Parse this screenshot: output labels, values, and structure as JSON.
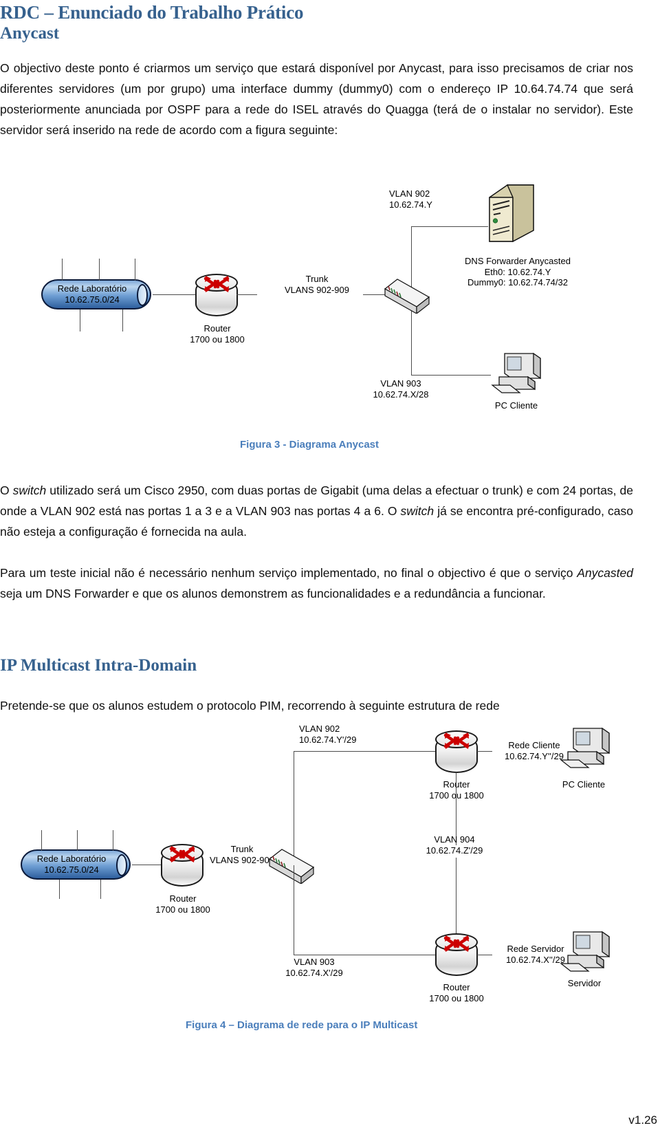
{
  "document": {
    "title": "RDC – Enunciado do Trabalho Prático",
    "version": "v1.26"
  },
  "sections": [
    {
      "id": "anycast",
      "heading": "Anycast",
      "paragraphs": [
        "O objectivo deste ponto é criarmos um serviço que estará disponível por Anycast, para isso precisamos de criar nos diferentes servidores (um por grupo) uma interface dummy (dummy0) com o endereço IP 10.64.74.74 que será posteriormente anunciada por OSPF para a rede do ISEL através do Quagga (terá de o instalar no servidor). Este servidor será inserido na rede de acordo com a figura seguinte:"
      ]
    },
    {
      "id": "multicast",
      "heading": "IP Multicast Intra-Domain",
      "paragraphs": [
        "Pretende-se que os alunos estudem o protocolo PIM, recorrendo à seguinte estrutura de rede"
      ]
    }
  ],
  "body_after_fig3": {
    "p1_pre": "O ",
    "p1_em1": "switch",
    "p1_mid": " utilizado será um Cisco 2950, com duas portas de Gigabit (uma delas a efectuar o trunk) e com 24 portas, de onde a VLAN 902 está nas portas 1 a 3 e a VLAN 903 nas portas 4 a 6. O ",
    "p1_em2": "switch",
    "p1_post": " já se encontra pré-configurado, caso não esteja a configuração é fornecida na aula.",
    "p2_pre": "Para um teste inicial não é necessário nenhum serviço implementado, no final o objectivo é que o serviço ",
    "p2_em1": "Anycasted",
    "p2_post": " seja um DNS Forwarder e que os alunos demonstrem as funcionalidades e a redundância a funcionar."
  },
  "figure3": {
    "caption": "Figura 3 - Diagrama Anycast",
    "nodes": {
      "lab_network": {
        "line1": "Rede Laboratório",
        "line2": "10.62.75.0/24",
        "icon": "network-cylinder-icon"
      },
      "router": {
        "line1": "Router",
        "line2": "1700 ou 1800",
        "icon": "router-icon"
      },
      "trunk": {
        "line1": "Trunk",
        "line2": "VLANS 902-909"
      },
      "switch": {
        "icon": "switch-icon"
      },
      "vlan902": {
        "line1": "VLAN 902",
        "line2": "10.62.74.Y"
      },
      "vlan903": {
        "line1": "VLAN 903",
        "line2": "10.62.74.X/28"
      },
      "server": {
        "icon": "server-tower-icon",
        "line1": "DNS Forwarder Anycasted",
        "line2": "Eth0: 10.62.74.Y",
        "line3": "Dummy0: 10.62.74.74/32"
      },
      "pc_client": {
        "icon": "desktop-pc-icon",
        "label": "PC Cliente"
      }
    }
  },
  "figure4": {
    "caption": "Figura 4 – Diagrama de rede para o IP Multicast",
    "nodes": {
      "vlan902": {
        "line1": "VLAN 902",
        "line2": "10.62.74.Y'/29"
      },
      "router_top": {
        "line1": "Router",
        "line2": "1700 ou 1800",
        "icon": "router-icon"
      },
      "rede_cliente": {
        "line1": "Rede Cliente",
        "line2": "10.62.74.Y''/29"
      },
      "pc_client": {
        "icon": "desktop-pc-icon",
        "label": "PC Cliente"
      },
      "lab_network": {
        "line1": "Rede Laboratório",
        "line2": "10.62.75.0/24",
        "icon": "network-cylinder-icon"
      },
      "router_left": {
        "line1": "Router",
        "line2": "1700 ou 1800",
        "icon": "router-icon"
      },
      "trunk": {
        "line1": "Trunk",
        "line2": "VLANS 902-909"
      },
      "switch": {
        "icon": "switch-icon"
      },
      "vlan904": {
        "line1": "VLAN 904",
        "line2": "10.62.74.Z'/29"
      },
      "vlan903": {
        "line1": "VLAN 903",
        "line2": "10.62.74.X'/29"
      },
      "router_bottom": {
        "line1": "Router",
        "line2": "1700 ou 1800",
        "icon": "router-icon"
      },
      "rede_servidor": {
        "line1": "Rede Servidor",
        "line2": "10.62.74.X''/29"
      },
      "server": {
        "icon": "desktop-pc-icon",
        "label": "Servidor"
      }
    }
  },
  "colors": {
    "heading": "#36618E",
    "caption": "#4A7EBB",
    "network_blue": "#2E5F9E",
    "router_red": "#CC0000",
    "server_beige": "#D6CFA8"
  }
}
